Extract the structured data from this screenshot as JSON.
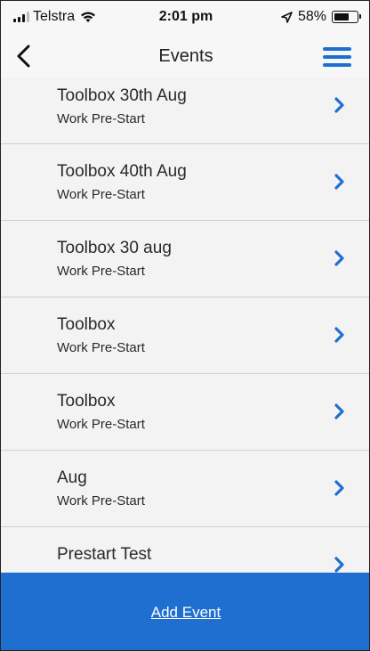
{
  "status_bar": {
    "carrier": "Telstra",
    "time": "2:01 pm",
    "battery": "58%",
    "battery_level": 0.58,
    "icons": [
      "signal-icon",
      "wifi-icon",
      "location-icon",
      "battery-icon"
    ]
  },
  "nav": {
    "title": "Events",
    "back_icon": "chevron-left-icon",
    "menu_icon": "hamburger-menu-icon"
  },
  "events": [
    {
      "title": "Toolbox 30th Aug",
      "subtitle": "Work Pre-Start"
    },
    {
      "title": "Toolbox 40th Aug",
      "subtitle": "Work Pre-Start"
    },
    {
      "title": "Toolbox 30 aug",
      "subtitle": "Work Pre-Start"
    },
    {
      "title": "Toolbox",
      "subtitle": "Work Pre-Start"
    },
    {
      "title": "Toolbox",
      "subtitle": "Work Pre-Start"
    },
    {
      "title": "Aug",
      "subtitle": "Work Pre-Start"
    },
    {
      "title": "Prestart Test",
      "subtitle": ""
    }
  ],
  "footer": {
    "add_event_label": "Add Event"
  },
  "colors": {
    "accent": "#1f6fd0",
    "chevron": "#1f6fd0",
    "background": "#f3f3f3"
  }
}
